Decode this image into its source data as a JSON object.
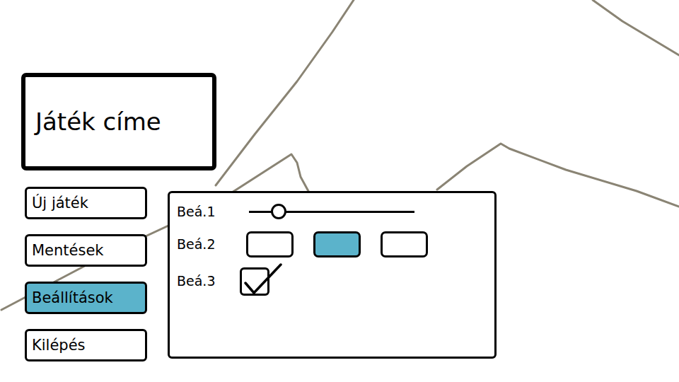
{
  "title": "Játék címe",
  "menu": [
    {
      "label": "Új játék",
      "selected": false
    },
    {
      "label": "Mentések",
      "selected": false
    },
    {
      "label": "Beállítások",
      "selected": true
    },
    {
      "label": "Kilépés",
      "selected": false
    }
  ],
  "settings": [
    {
      "label": "Beá.1",
      "kind": "slider",
      "level": 0.18
    },
    {
      "label": "Beá.2",
      "kind": "choice",
      "options": [
        {
          "selected": false
        },
        {
          "selected": true
        },
        {
          "selected": false
        }
      ]
    },
    {
      "label": "Beá.3",
      "kind": "checkbox",
      "checked": true
    }
  ]
}
